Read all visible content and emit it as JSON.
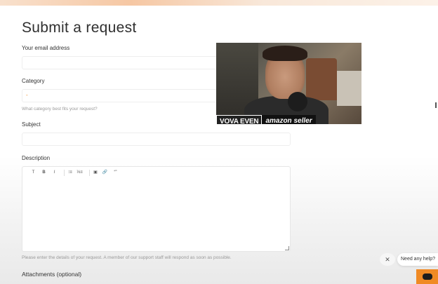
{
  "form": {
    "title": "Submit a request",
    "email_label": "Your email address",
    "category_label": "Category",
    "category_value": "-",
    "category_hint": "What category best fits your request?",
    "subject_label": "Subject",
    "description_label": "Description",
    "description_hint": "Please enter the details of your request. A member of our support staff will respond as soon as possible.",
    "attachments_label": "Attachments (optional)"
  },
  "editor_toolbar": {
    "bold": "B",
    "italic": "I",
    "text_style": "T",
    "bulleted_list": "⁝≡",
    "numbered_list": "⅓≡",
    "image": "▣",
    "link": "🔗",
    "code": "“”"
  },
  "video_overlay": {
    "name": "VOVA EVEN",
    "role": "amazon seller"
  },
  "help_widget": {
    "close": "✕",
    "bubble_text": "Need any help?"
  },
  "colors": {
    "accent": "#f08a24"
  }
}
